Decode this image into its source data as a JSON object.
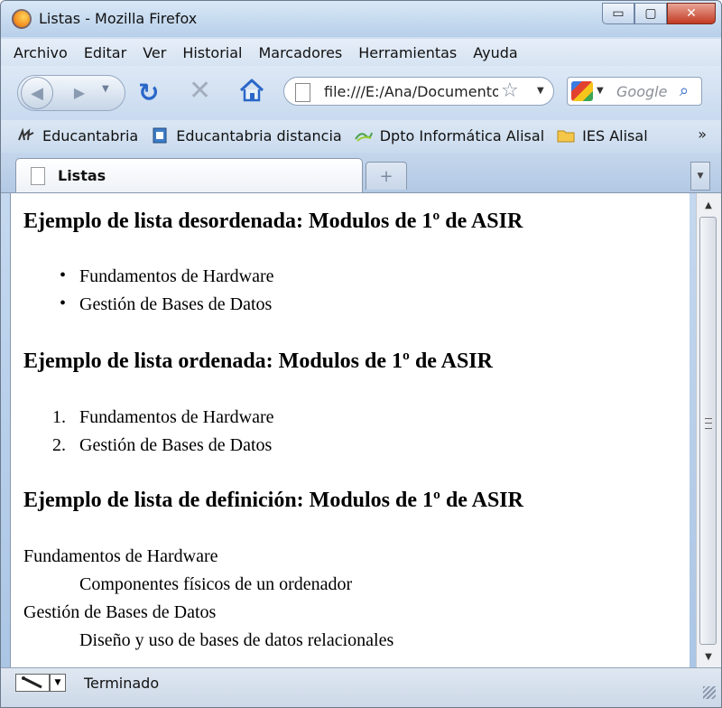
{
  "window": {
    "title": "Listas - Mozilla Firefox",
    "controls": {
      "minimize": "▭",
      "maximize": "▢",
      "close": "✕"
    }
  },
  "menubar": {
    "items": [
      "Archivo",
      "Editar",
      "Ver",
      "Historial",
      "Marcadores",
      "Herramientas",
      "Ayuda"
    ]
  },
  "navbar": {
    "back_glyph": "◀",
    "forward_glyph": "▶",
    "reload_glyph": "↻",
    "stop_glyph": "✕",
    "url": "file:///E:/Ana/Documentos",
    "star_glyph": "☆",
    "search_placeholder": "Google",
    "search_glyph": "⌕"
  },
  "bookmarks": {
    "items": [
      "Educantabria",
      "Educantabria distancia",
      "Dpto Informática Alisal",
      "IES Alisal"
    ],
    "more": "»"
  },
  "tabs": {
    "active_label": "Listas",
    "new_tab_glyph": "+"
  },
  "page": {
    "h_unordered": "Ejemplo de lista desordenada: Modulos de 1º de ASIR",
    "unordered_items": [
      "Fundamentos de Hardware",
      "Gestión de Bases de Datos"
    ],
    "h_ordered": "Ejemplo de lista ordenada: Modulos de 1º de ASIR",
    "ordered_items": [
      "Fundamentos de Hardware",
      "Gestión de Bases de Datos"
    ],
    "ordered_markers": [
      "1.",
      "2."
    ],
    "h_definition": "Ejemplo de lista de definición: Modulos de 1º de ASIR",
    "definitions": [
      {
        "term": "Fundamentos de Hardware",
        "desc": "Componentes físicos de un ordenador"
      },
      {
        "term": "Gestión de Bases de Datos",
        "desc": "Diseño y uso de bases de datos relacionales"
      }
    ]
  },
  "statusbar": {
    "text": "Terminado"
  },
  "colors": {
    "accent": "#2a67c8",
    "close_button": "#c23a22"
  },
  "icons": [
    "firefox-icon",
    "back-icon",
    "forward-icon",
    "reload-icon",
    "stop-icon",
    "home-icon",
    "page-icon",
    "bookmark-star-icon",
    "google-icon",
    "search-icon",
    "folder-icon"
  ]
}
